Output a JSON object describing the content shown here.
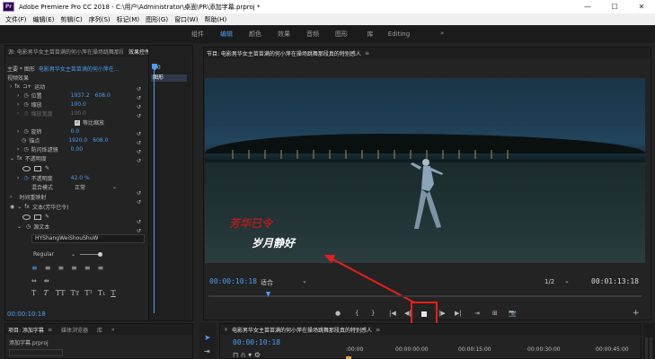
{
  "window": {
    "app_logo": "Pr",
    "title": "Adobe Premiere Pro CC 2018 - C:\\用户\\Administrator\\桌面\\PR\\添加字幕.prproj *",
    "minimize": "—",
    "maximize": "☐",
    "close": "✕"
  },
  "menu": [
    "文件(F)",
    "编辑(E)",
    "剪辑(C)",
    "序列(S)",
    "标记(M)",
    "图形(G)",
    "窗口(W)",
    "帮助(H)"
  ],
  "workspaces": {
    "tabs": [
      "组件",
      "编辑",
      "颜色",
      "效果",
      "音频",
      "图形",
      "库",
      "Editing"
    ],
    "active_index": 1,
    "more": "»"
  },
  "effect_controls": {
    "header": {
      "source_tab": "源: 电影男华女主苗苗满的何小萍在操场跳舞那段真的特别感人.mp4",
      "effect_tab": "效果控件",
      "menu": "≡"
    },
    "clip_path": "主要 * 图形",
    "clip_link": "电影男华女主苗苗满的何小萍在...",
    "keyframe_time": ":00",
    "keyframe_clip": "图形",
    "video_effects_label": "视频效果",
    "motion": {
      "name": "运动",
      "position_label": "位置",
      "position_x": "1937.2",
      "position_y": "608.0",
      "scale_label": "缩放",
      "scale_value": "100.0",
      "scale_width_label": "缩放宽度",
      "scale_width_value": "100.0",
      "uniform_scale_label": "等比缩放",
      "rotation_label": "旋转",
      "rotation_value": "0.0",
      "anchor_label": "锚点",
      "anchor_x": "1920.0",
      "anchor_y": "608.0",
      "antiflicker_label": "防闪烁滤镜",
      "antiflicker_value": "0.00"
    },
    "opacity": {
      "name": "不透明度",
      "opacity_label": "不透明度",
      "opacity_value": "42.0",
      "opacity_unit": "%",
      "blend_label": "混合模式",
      "blend_value": "正常"
    },
    "time_remap": "时间重映射",
    "text": {
      "name": "文本(芳华已令)",
      "source_text_label": "源文本",
      "font_value": "HYShangWeiShouShuW",
      "style_value": "Regular"
    },
    "timecode": "00:00:10:18"
  },
  "program": {
    "header": "节目: 电影男华女主苗苗满的何小萍在操场跳舞那段真的特别感人",
    "menu": "≡",
    "caption_red": "芳华已令",
    "caption_white": "岁月静好",
    "current_time": "00:00:10:18",
    "fit": "适合",
    "resolution": "1/2",
    "duration": "00:01:13:18",
    "transport": [
      "●",
      "{",
      "}",
      "|◀",
      "◀|",
      "▶",
      "|▶",
      "▶|",
      "⇥",
      "⊞",
      "⊟",
      "📷",
      "+"
    ]
  },
  "project": {
    "tab": "项目: 添加字幕",
    "media_browser": "媒体浏览器",
    "library": "库",
    "filename": "添加字幕.prproj"
  },
  "timeline": {
    "tab": "电影男华女主苗苗满的何小萍在操场跳舞那段真的特别感人",
    "timecode": "00:00:10:18",
    "ruler": [
      ":00:00",
      "00:00:00:00",
      "00:00:15:00",
      "00:00:30:00",
      "00:00:45:00"
    ]
  },
  "colors": {
    "accent_blue": "#4c9cf1",
    "highlight_red": "#e81e1e",
    "caption_red": "#b21d1d"
  }
}
